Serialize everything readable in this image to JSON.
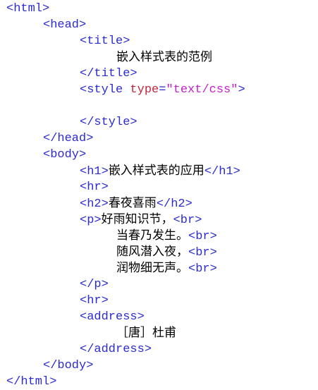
{
  "lines": [
    {
      "indent": 0,
      "parts": [
        {
          "t": "tag",
          "v": "<html>"
        }
      ]
    },
    {
      "indent": 1,
      "parts": [
        {
          "t": "tag",
          "v": "<head>"
        }
      ]
    },
    {
      "indent": 2,
      "parts": [
        {
          "t": "tag",
          "v": "<title>"
        }
      ]
    },
    {
      "indent": 3,
      "parts": [
        {
          "t": "txt",
          "v": "嵌入样式表的范例"
        }
      ]
    },
    {
      "indent": 2,
      "parts": [
        {
          "t": "tag",
          "v": "</title>"
        }
      ]
    },
    {
      "indent": 2,
      "parts": [
        {
          "t": "tag",
          "v": "<style "
        },
        {
          "t": "attr",
          "v": "type"
        },
        {
          "t": "tag",
          "v": "="
        },
        {
          "t": "val",
          "v": "\"text/css\""
        },
        {
          "t": "tag",
          "v": ">"
        }
      ]
    },
    {
      "indent": 2,
      "parts": []
    },
    {
      "indent": 2,
      "parts": [
        {
          "t": "tag",
          "v": "</style>"
        }
      ]
    },
    {
      "indent": 1,
      "parts": [
        {
          "t": "tag",
          "v": "</head>"
        }
      ]
    },
    {
      "indent": 1,
      "parts": [
        {
          "t": "tag",
          "v": "<body>"
        }
      ]
    },
    {
      "indent": 2,
      "parts": [
        {
          "t": "tag",
          "v": "<h1>"
        },
        {
          "t": "txt",
          "v": "嵌入样式表的应用"
        },
        {
          "t": "tag",
          "v": "</h1>"
        }
      ]
    },
    {
      "indent": 2,
      "parts": [
        {
          "t": "tag",
          "v": "<hr>"
        }
      ]
    },
    {
      "indent": 2,
      "parts": [
        {
          "t": "tag",
          "v": "<h2>"
        },
        {
          "t": "txt",
          "v": "春夜喜雨"
        },
        {
          "t": "tag",
          "v": "</h2>"
        }
      ]
    },
    {
      "indent": 2,
      "parts": [
        {
          "t": "tag",
          "v": "<p>"
        },
        {
          "t": "txt",
          "v": "好雨知识节，"
        },
        {
          "t": "tag",
          "v": "<br>"
        }
      ]
    },
    {
      "indent": 3,
      "parts": [
        {
          "t": "txt",
          "v": "当春乃发生。"
        },
        {
          "t": "tag",
          "v": "<br>"
        }
      ]
    },
    {
      "indent": 3,
      "parts": [
        {
          "t": "txt",
          "v": "随风潜入夜，"
        },
        {
          "t": "tag",
          "v": "<br>"
        }
      ]
    },
    {
      "indent": 3,
      "parts": [
        {
          "t": "txt",
          "v": "润物细无声。"
        },
        {
          "t": "tag",
          "v": "<br>"
        }
      ]
    },
    {
      "indent": 2,
      "parts": [
        {
          "t": "tag",
          "v": "</p>"
        }
      ]
    },
    {
      "indent": 2,
      "parts": [
        {
          "t": "tag",
          "v": "<hr>"
        }
      ]
    },
    {
      "indent": 2,
      "parts": [
        {
          "t": "tag",
          "v": "<address>"
        }
      ]
    },
    {
      "indent": 3,
      "parts": [
        {
          "t": "txt",
          "v": "［唐］杜甫"
        }
      ]
    },
    {
      "indent": 2,
      "parts": [
        {
          "t": "tag",
          "v": "</address>"
        }
      ]
    },
    {
      "indent": 1,
      "parts": [
        {
          "t": "tag",
          "v": "</body>"
        }
      ]
    },
    {
      "indent": 0,
      "parts": [
        {
          "t": "tag",
          "v": "</html>"
        }
      ]
    }
  ],
  "colors": {
    "tag": "#2b2bd1",
    "attribute": "#c0283a",
    "string": "#c21fc8",
    "text": "#000000",
    "background": "#ffffff"
  }
}
